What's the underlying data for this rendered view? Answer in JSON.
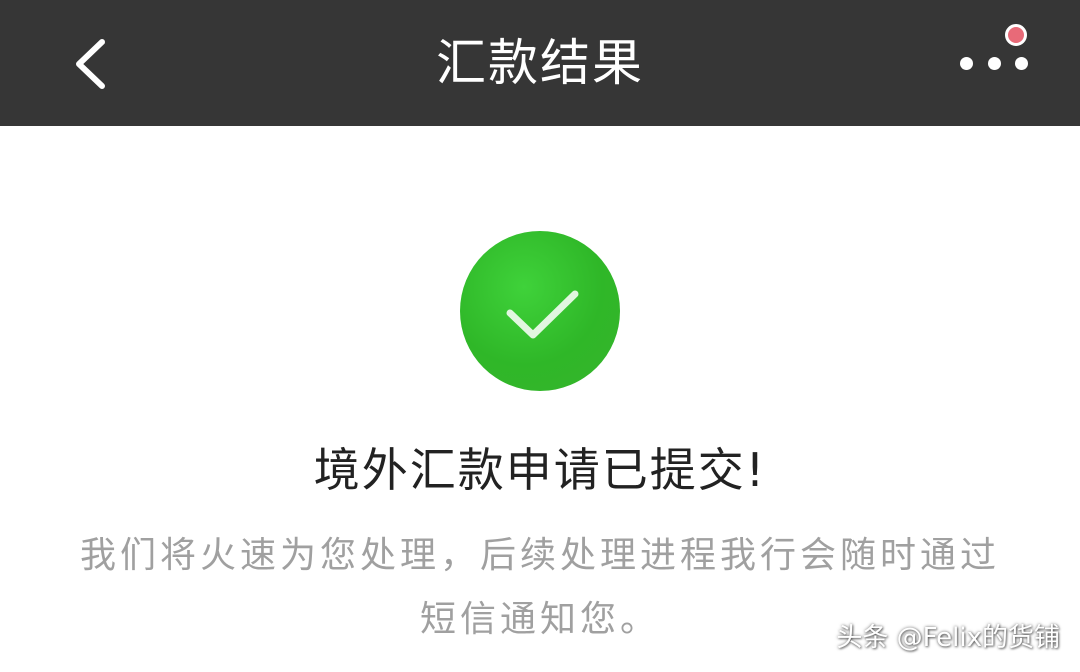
{
  "header": {
    "title": "汇款结果",
    "back_icon": "chevron-left-icon",
    "more_icon": "more-dots-icon",
    "badge_color": "#e86a78",
    "background_color": "#363636"
  },
  "result": {
    "status_icon": "check-circle-icon",
    "status_color": "#2fb728",
    "headline": "境外汇款申请已提交!",
    "description": "我们将火速为您处理，后续处理进程我行会随时通过短信通知您。"
  },
  "watermark": {
    "text": "头条 @Felix的货铺"
  }
}
